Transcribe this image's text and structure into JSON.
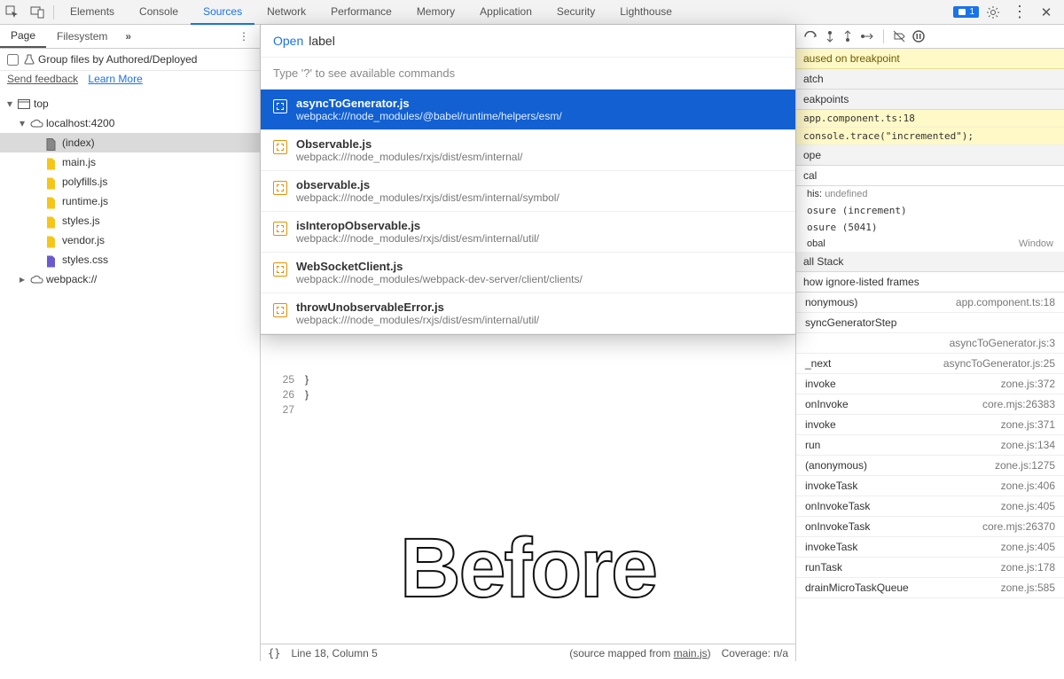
{
  "top_tabs": [
    "Elements",
    "Console",
    "Sources",
    "Network",
    "Performance",
    "Memory",
    "Application",
    "Security",
    "Lighthouse"
  ],
  "active_top_tab": 2,
  "badge_count": "1",
  "left": {
    "tabs": [
      "Page",
      "Filesystem"
    ],
    "group_label": "Group files by Authored/Deployed",
    "send_feedback": "Send feedback",
    "learn_more": "Learn More",
    "tree": [
      {
        "indent": 0,
        "label": "top",
        "icon": "window",
        "arrow": "down"
      },
      {
        "indent": 1,
        "label": "localhost:4200",
        "icon": "cloud",
        "arrow": "down"
      },
      {
        "indent": 2,
        "label": "(index)",
        "icon": "doc",
        "selected": true
      },
      {
        "indent": 2,
        "label": "main.js",
        "icon": "js"
      },
      {
        "indent": 2,
        "label": "polyfills.js",
        "icon": "js"
      },
      {
        "indent": 2,
        "label": "runtime.js",
        "icon": "js"
      },
      {
        "indent": 2,
        "label": "styles.js",
        "icon": "js"
      },
      {
        "indent": 2,
        "label": "vendor.js",
        "icon": "js"
      },
      {
        "indent": 2,
        "label": "styles.css",
        "icon": "css"
      },
      {
        "indent": 1,
        "label": "webpack://",
        "icon": "cloud",
        "arrow": "right"
      }
    ]
  },
  "cmd": {
    "prefix": "Open",
    "value": "label",
    "hint": "Type '?' to see available commands",
    "items": [
      {
        "title": "asyncToGenerator.js",
        "path": "webpack:///node_modules/@babel/runtime/helpers/esm/",
        "selected": true,
        "hl_title": []
      },
      {
        "title": "Observable.js",
        "path": "webpack:///node_modules/rxjs/dist/esm/internal/",
        "hl_title": [
          9,
          10,
          11
        ]
      },
      {
        "title": "observable.js",
        "path": "webpack:///node_modules/rxjs/dist/esm/internal/symbol/",
        "hl_title": [
          9,
          10,
          11
        ]
      },
      {
        "title": "isInteropObservable.js",
        "path": "webpack:///node_modules/rxjs/dist/esm/internal/util/",
        "hl_title": []
      },
      {
        "title": "WebSocketClient.js",
        "path": "webpack:///node_modules/webpack-dev-server/client/clients/",
        "hl_title": []
      },
      {
        "title": "throwUnobservableError.js",
        "path": "webpack:///node_modules/rxjs/dist/esm/internal/util/",
        "hl_title": []
      }
    ]
  },
  "editor": {
    "gutter": [
      "25",
      "26",
      "27"
    ],
    "code": [
      "  }",
      "}",
      ""
    ]
  },
  "watermark": "Before",
  "status": {
    "brackets": "{}",
    "pos": "Line 18, Column 5",
    "mapped_prefix": "(source mapped from ",
    "mapped_file": "main.js",
    "mapped_suffix": ")",
    "coverage": "Coverage: n/a"
  },
  "right": {
    "paused": "aused on breakpoint",
    "watch": "atch",
    "breakpoints": "eakpoints",
    "bp1": "app.component.ts:18",
    "bp2": "console.trace(\"incremented\");",
    "scope": "ope",
    "local": "cal",
    "this_label": "his:",
    "this_val": "undefined",
    "closure1": "osure (increment)",
    "closure2": "osure (5041)",
    "global": "obal",
    "global_val": "Window",
    "callstack": "all Stack",
    "ignore_listed": "how ignore-listed frames",
    "frames": [
      {
        "fn": "nonymous)",
        "loc": "app.component.ts:18"
      },
      {
        "fn": "syncGeneratorStep",
        "loc": ""
      },
      {
        "fn": "",
        "loc": "asyncToGenerator.js:3"
      },
      {
        "fn": "_next",
        "loc": "asyncToGenerator.js:25"
      },
      {
        "fn": "invoke",
        "loc": "zone.js:372"
      },
      {
        "fn": "onInvoke",
        "loc": "core.mjs:26383"
      },
      {
        "fn": "invoke",
        "loc": "zone.js:371"
      },
      {
        "fn": "run",
        "loc": "zone.js:134"
      },
      {
        "fn": "(anonymous)",
        "loc": "zone.js:1275"
      },
      {
        "fn": "invokeTask",
        "loc": "zone.js:406"
      },
      {
        "fn": "onInvokeTask",
        "loc": "zone.js:405"
      },
      {
        "fn": "onInvokeTask",
        "loc": "core.mjs:26370"
      },
      {
        "fn": "invokeTask",
        "loc": "zone.js:405"
      },
      {
        "fn": "runTask",
        "loc": "zone.js:178"
      },
      {
        "fn": "drainMicroTaskQueue",
        "loc": "zone.js:585"
      }
    ]
  }
}
